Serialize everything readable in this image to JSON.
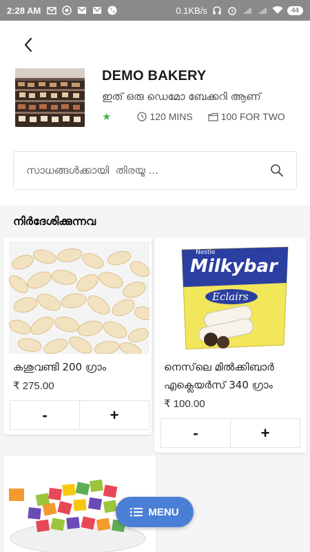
{
  "status_bar": {
    "time": "2:28 AM",
    "speed": "0.1KB/s",
    "battery": "44",
    "icons": [
      "mail-icon",
      "whatsapp-icon",
      "gmail-icon",
      "gmail-icon",
      "phone-icon",
      "headphones-icon",
      "alarm-icon",
      "signal-icon",
      "signal-icon",
      "wifi-icon"
    ]
  },
  "header": {
    "back_icon": "back-arrow-icon",
    "store_name": "DEMO BAKERY",
    "store_description": "ഇത് ഒരു ഡെമോ ബേക്കറി ആണ്",
    "rating_icon": "star-icon",
    "delivery_time": "120 MINS",
    "cost_for_two": "100 FOR TWO"
  },
  "search": {
    "placeholder": "സാധങ്ങൾക്കായി  തിരയൂ ...",
    "icon": "search-icon"
  },
  "recommended": {
    "title": "നിർദേശിക്കുന്നവ",
    "products": [
      {
        "name": "കശുവണ്ടി 200 ഗ്രാം",
        "price": "₹ 275.00",
        "minus": "-",
        "plus": "+"
      },
      {
        "name_line1": "നെസ്‌ലെ മിൽക്കിബാർ",
        "name_line2": "എക്ലെയർസ് 340 ഗ്രാം",
        "price": "₹ 100.00",
        "minus": "-",
        "plus": "+"
      }
    ]
  },
  "fab": {
    "label": "MENU",
    "icon": "list-icon"
  },
  "colors": {
    "accent": "#4a7fd6",
    "star": "#4caf50",
    "status_bar": "#8a8a8a"
  }
}
